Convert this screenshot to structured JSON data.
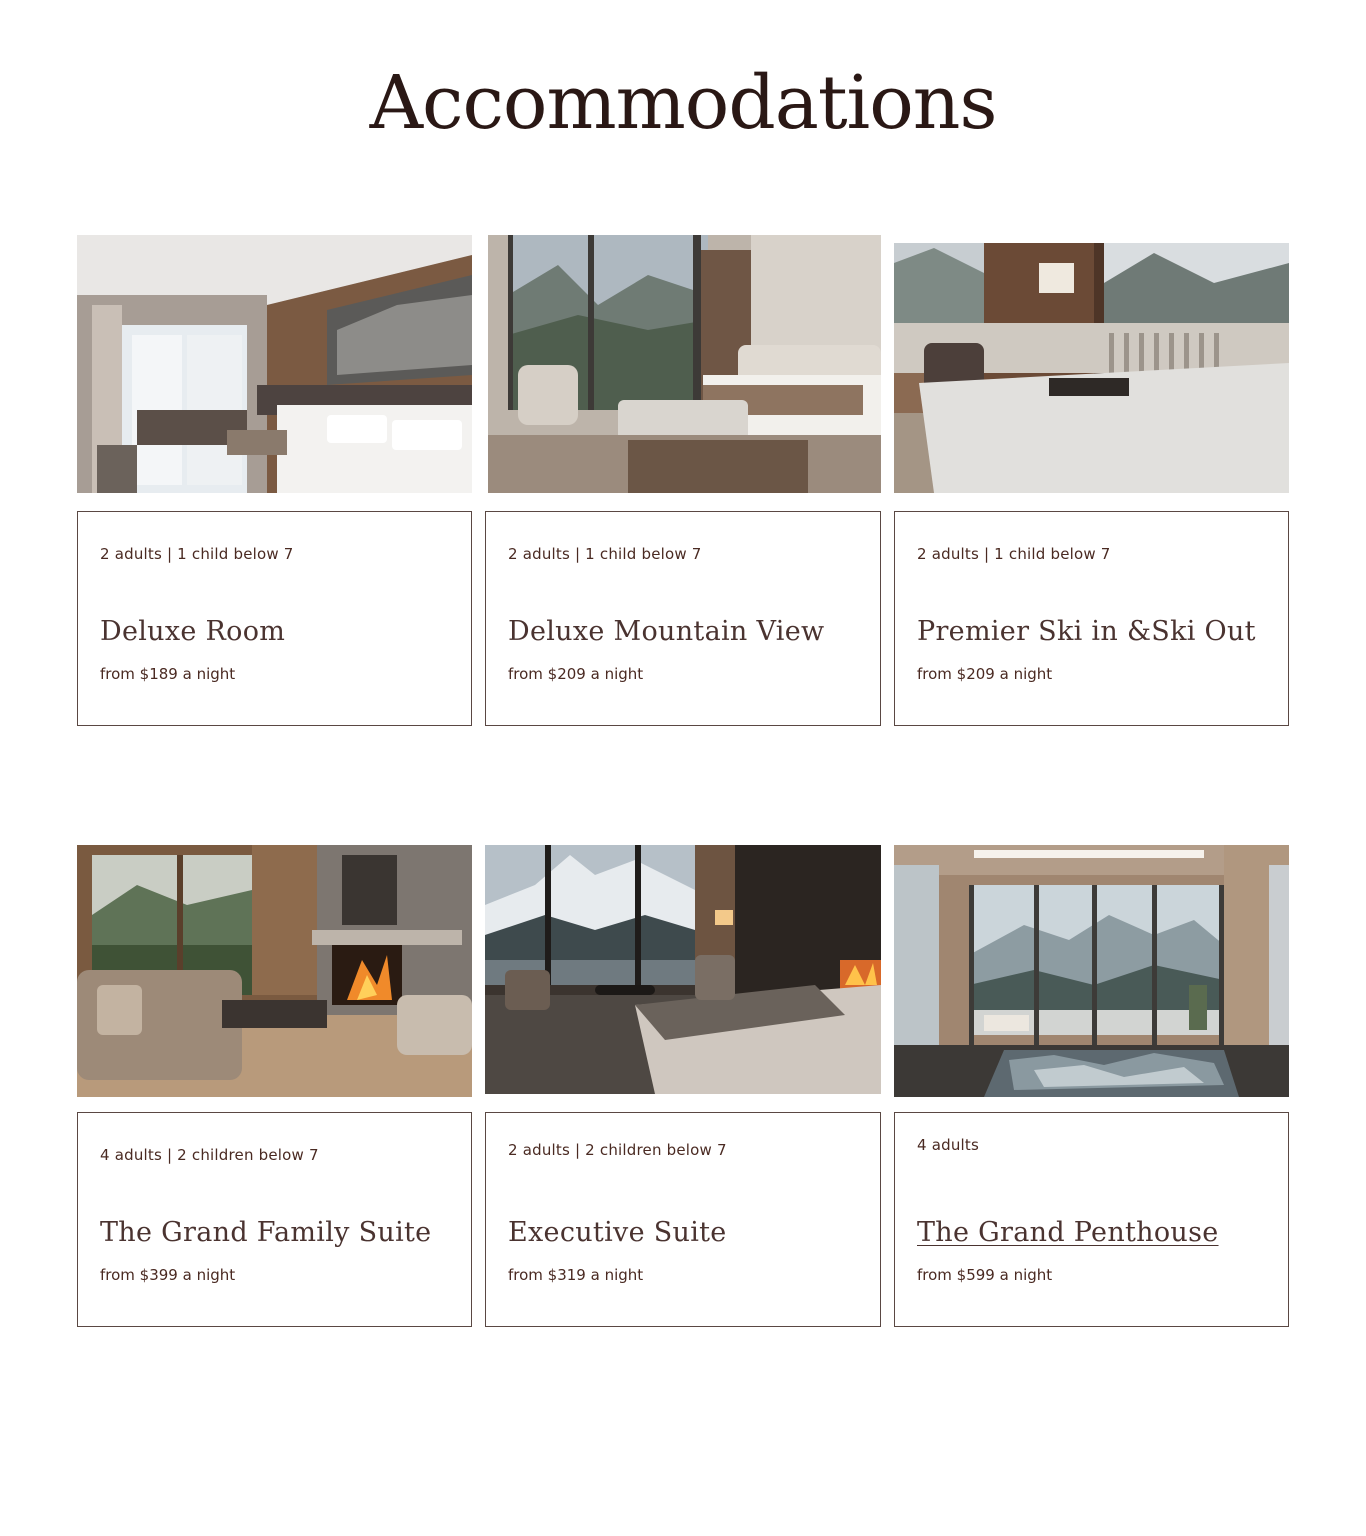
{
  "page": {
    "title": "Accommodations"
  },
  "rooms": [
    {
      "occupancy": "2 adults | 1 child below 7",
      "name": "Deluxe Room",
      "price": "from $189 a night",
      "photo_icon": "bedroom-photo"
    },
    {
      "occupancy": "2 adults | 1 child below 7",
      "name": "Deluxe Mountain View",
      "price": "from $209 a night",
      "photo_icon": "bedroom-mountain-view-photo"
    },
    {
      "occupancy": "2 adults | 1 child below 7",
      "name": "Premier Ski in &Ski Out",
      "price": "from $209 a night",
      "photo_icon": "bedroom-balcony-photo"
    },
    {
      "occupancy": "4 adults | 2 children below 7",
      "name": "The Grand Family Suite",
      "price": "from $399 a night",
      "photo_icon": "living-room-fireplace-photo"
    },
    {
      "occupancy": "2 adults | 2 children below 7",
      "name": "Executive Suite",
      "price": "from $319 a night",
      "photo_icon": "suite-bedroom-photo"
    },
    {
      "occupancy": "4 adults",
      "name": "The Grand Penthouse",
      "price": "from $599 a night",
      "photo_icon": "penthouse-pool-photo"
    }
  ],
  "colors": {
    "text_dark": "#2a1815",
    "text_body": "#4a2a22",
    "card_border": "#5a4843",
    "background": "#ffffff"
  }
}
